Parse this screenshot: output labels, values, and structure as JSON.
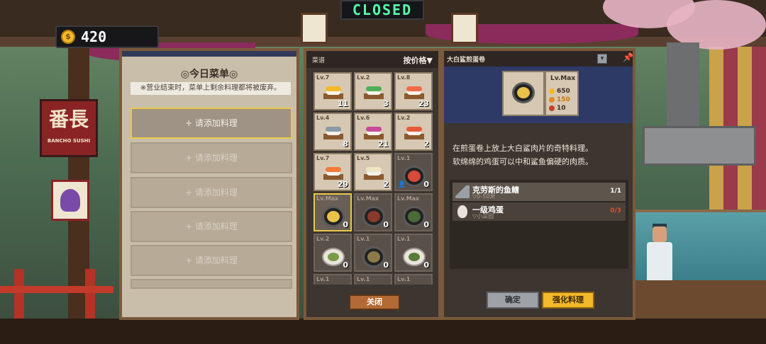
{
  "sign": {
    "closed": "CLOSED"
  },
  "coins": {
    "value": "420"
  },
  "logo": {
    "main": "番長",
    "sub": "BANCHO SUSHI"
  },
  "menu": {
    "title": "◎今日菜单◎",
    "note": "※营业结束时，菜单上剩余料理都将被废弃。",
    "slots": [
      {
        "label": "+ 请添加料理"
      },
      {
        "label": "+ 请添加料理"
      },
      {
        "label": "+ 请添加料理"
      },
      {
        "label": "+ 请添加料理"
      },
      {
        "label": "+ 请添加料理"
      }
    ]
  },
  "recipes": {
    "header": "菜谱",
    "sort_label": "按价格▼",
    "items": [
      {
        "level": "Lv.7",
        "count": "11",
        "kind": "sushi",
        "topping": "#f3b92b"
      },
      {
        "level": "Lv.2",
        "count": "3",
        "kind": "sushi",
        "topping": "#4fae5a"
      },
      {
        "level": "Lv.8",
        "count": "23",
        "kind": "sushi",
        "topping": "#f06a4a"
      },
      {
        "level": "Lv.4",
        "count": "8",
        "kind": "sushi",
        "topping": "#8a9aa8"
      },
      {
        "level": "Lv.6",
        "count": "21",
        "kind": "sushi",
        "topping": "#c84a9a"
      },
      {
        "level": "Lv.2",
        "count": "2",
        "kind": "sushi",
        "topping": "#e65a3a"
      },
      {
        "level": "Lv.7",
        "count": "29",
        "kind": "sushi",
        "topping": "#f27a3a"
      },
      {
        "level": "Lv.5",
        "count": "2",
        "kind": "sushi",
        "topping": "#efe4c4"
      },
      {
        "level": "Lv.1",
        "count": "0",
        "kind": "bowl",
        "topping": "#d94a3a",
        "person": "👤"
      },
      {
        "level": "Lv.Max",
        "count": "0",
        "kind": "bowl",
        "topping": "#e9c24b"
      },
      {
        "level": "Lv.Max",
        "count": "0",
        "kind": "bowl",
        "topping": "#8a3a2a"
      },
      {
        "level": "Lv.Max",
        "count": "0",
        "kind": "bowl",
        "topping": "#4a6a3a"
      },
      {
        "level": "Lv.2",
        "count": "0",
        "kind": "plate",
        "topping": "#7a9a4a"
      },
      {
        "level": "Lv.1",
        "count": "0",
        "kind": "bowl",
        "topping": "#8a7a4a"
      },
      {
        "level": "Lv.1",
        "count": "0",
        "kind": "plate",
        "topping": "#5a7a3a"
      },
      {
        "level": "Lv.1",
        "count": "",
        "kind": "none",
        "topping": "#000000"
      },
      {
        "level": "Lv.1",
        "count": "",
        "kind": "none",
        "topping": "#000000"
      },
      {
        "level": "Lv.1",
        "count": "",
        "kind": "none",
        "topping": "#000000"
      }
    ],
    "close_label": "关闭"
  },
  "detail": {
    "name": "大白鲨煎蛋卷",
    "level": "Lv.Max",
    "price": "650",
    "taste": "150",
    "stock": "10",
    "description": "在煎蛋卷上放上大白鲨肉片的奇特料理。\n软绵绵的鸡蛋可以中和鲨鱼偏硬的肉质。",
    "ingredients": [
      {
        "name": "克劳斯的鱼鳍",
        "sub": "▽0-50米",
        "count": "1/1",
        "count_color": "#ffffff"
      },
      {
        "name": "一级鸡蛋",
        "sub": "▽小菜园",
        "count": "0/3",
        "count_color": "#e8463a"
      }
    ],
    "confirm_label": "确定",
    "upgrade_label": "强化料理"
  },
  "colors": {
    "accent": "#f3b92b",
    "panel_border": "#7a5a3c",
    "selected": "#e9c84b"
  }
}
